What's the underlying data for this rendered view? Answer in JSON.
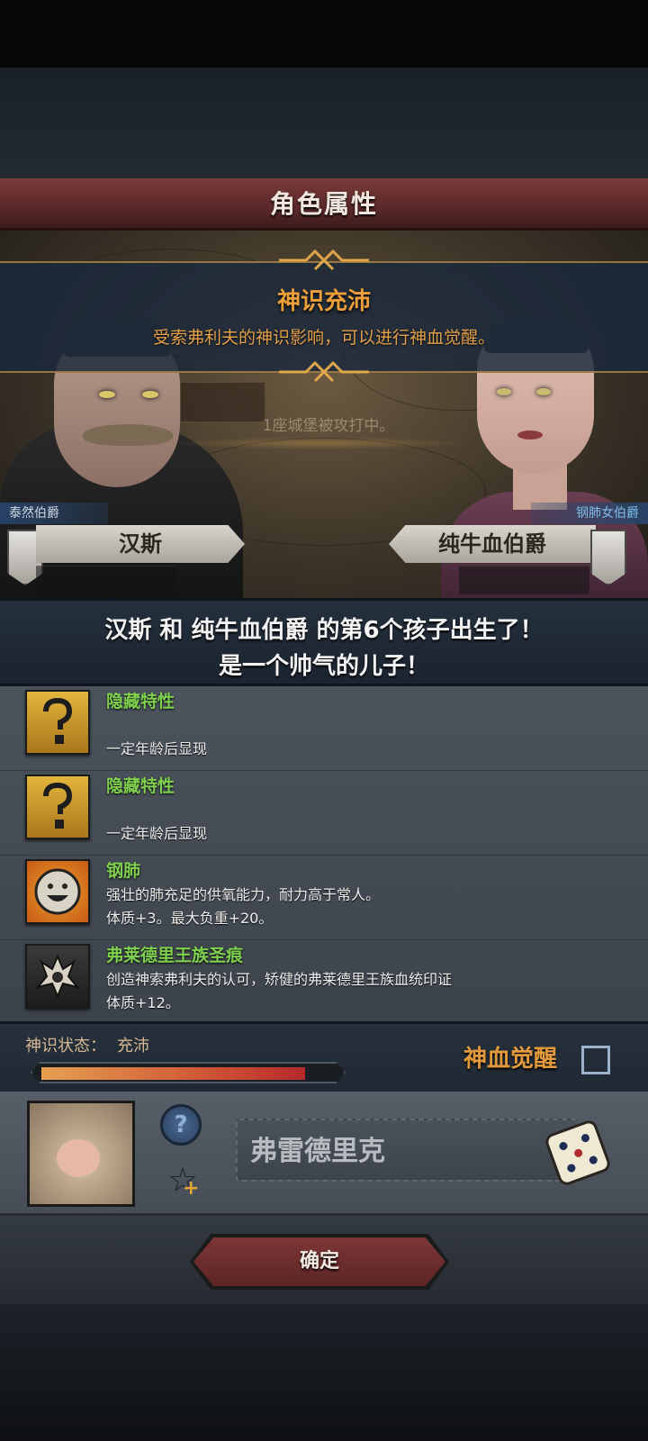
{
  "header": {
    "title": "角色属性"
  },
  "event": {
    "title": "神识充沛",
    "description": "受索弗利夫的神识影响，可以进行神血觉醒。",
    "map_note": "1座城堡被攻打中。"
  },
  "parents": {
    "father": {
      "title": "泰然伯爵",
      "name": "汉斯"
    },
    "mother": {
      "title": "钢肺女伯爵",
      "name": "纯牛血伯爵"
    }
  },
  "announcement": {
    "line1": "汉斯 和 纯牛血伯爵 的第6个孩子出生了！",
    "line2": "是一个帅气的儿子！"
  },
  "traits": [
    {
      "name": "隐藏特性",
      "icon": "question-mark-icon",
      "lines": [
        "",
        "一定年龄后显现"
      ]
    },
    {
      "name": "隐藏特性",
      "icon": "question-mark-icon",
      "lines": [
        "",
        "一定年龄后显现"
      ]
    },
    {
      "name": "钢肺",
      "icon": "smiling-face-icon",
      "lines": [
        "强壮的肺充足的供氧能力，耐力高于常人。",
        "体质+3。最大负重+20。"
      ]
    },
    {
      "name": "弗莱德里王族圣痕",
      "icon": "royal-stigma-icon",
      "lines": [
        "创造神索弗利夫的认可，矫健的弗莱德里王族血统印证",
        "体质+12。"
      ]
    }
  ],
  "status": {
    "label": "神识状态：",
    "value": "充沛",
    "level_fraction": 0.9,
    "awaken_label": "神血觉醒",
    "awaken_checked": false
  },
  "child": {
    "name": "弗雷德里克",
    "help_icon": "question-icon",
    "favorite_icon": "star-plus-icon",
    "random_icon": "dice-icon"
  },
  "confirm_label": "确定",
  "colors": {
    "accent_orange": "#ec9f3a",
    "trait_green": "#7ed04e",
    "button_red": "#7e3737"
  }
}
